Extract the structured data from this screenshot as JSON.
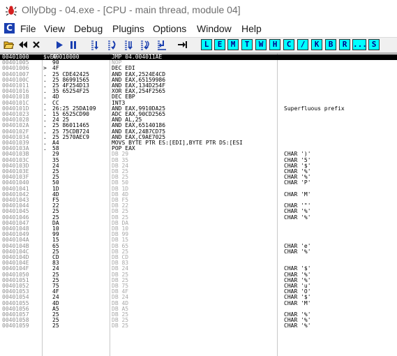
{
  "window": {
    "title": "OllyDbg - 04.exe - [CPU - main thread, module 04]"
  },
  "menu": {
    "logo": "C",
    "items": [
      "File",
      "View",
      "Debug",
      "Plugins",
      "Options",
      "Window",
      "Help"
    ]
  },
  "toolbar": {
    "icons": [
      "open-folder-icon",
      "rewind-icon",
      "close-icon",
      "run-icon",
      "pause-icon",
      "step-into-icon",
      "step-over-icon",
      "trace-into-icon",
      "trace-over-icon",
      "execute-till-return-icon",
      "go-to-icon"
    ],
    "letters": [
      "L",
      "E",
      "M",
      "T",
      "W",
      "H",
      "C",
      "/",
      "K",
      "B",
      "R",
      "...",
      "S"
    ],
    "letter_color": "#00ffff"
  },
  "disasm": {
    "rows": [
      {
        "addr": "00401000",
        "mark": "$vE9",
        "hex": "A9010000",
        "dis": "JMP 04.004011AE",
        "com": "",
        "sel": true
      },
      {
        "addr": "00401005",
        "mark": "",
        "hex": "90",
        "dis": "NOP",
        "com": "",
        "nop": true
      },
      {
        "addr": "00401006",
        "mark": ">",
        "hex": "4F",
        "dis": "DEC EDI",
        "com": ""
      },
      {
        "addr": "00401007",
        "mark": ".",
        "hex": "25 CDE42425",
        "dis": "AND EAX,2524E4CD",
        "com": ""
      },
      {
        "addr": "0040100C",
        "mark": ".",
        "hex": "25 86991565",
        "dis": "AND EAX,65159986",
        "com": ""
      },
      {
        "addr": "00401011",
        "mark": ".",
        "hex": "25 4F254D13",
        "dis": "AND EAX,134D254F",
        "com": ""
      },
      {
        "addr": "00401016",
        "mark": ".",
        "hex": "35 65254F25",
        "dis": "XOR EAX,254F2565",
        "com": ""
      },
      {
        "addr": "0040101B",
        "mark": ".",
        "hex": "4D",
        "dis": "DEC EBP",
        "com": ""
      },
      {
        "addr": "0040101C",
        "mark": ".",
        "hex": "CC",
        "dis": "INT3",
        "com": ""
      },
      {
        "addr": "0040101D",
        "mark": ".",
        "hex": "26:25 25DA109",
        "dis": "AND EAX,9910DA25",
        "com": "Superfluous prefix"
      },
      {
        "addr": "00401023",
        "mark": ".",
        "hex": "15 6525CD90",
        "dis": "ADC EAX,90CD2565",
        "com": ""
      },
      {
        "addr": "00401028",
        "mark": ".",
        "hex": "24 25",
        "dis": "AND AL,25",
        "com": ""
      },
      {
        "addr": "0040102A",
        "mark": ".",
        "hex": "25 86011465",
        "dis": "AND EAX,65140186",
        "com": ""
      },
      {
        "addr": "0040102F",
        "mark": ".",
        "hex": "25 75CDB724",
        "dis": "AND EAX,24B7CD75",
        "com": ""
      },
      {
        "addr": "00401034",
        "mark": ".",
        "hex": "25 2570AEC9",
        "dis": "AND EAX,C9AE7025",
        "com": ""
      },
      {
        "addr": "00401039",
        "mark": ".",
        "hex": "A4",
        "dis": "MOVS BYTE PTR ES:[EDI],BYTE PTR DS:[ESI",
        "com": ""
      },
      {
        "addr": "0040103A",
        "mark": ".",
        "hex": "58",
        "dis": "POP EAX",
        "com": ""
      },
      {
        "addr": "0040103B",
        "mark": "",
        "hex": "29",
        "dis": "DB 29",
        "com": "CHAR ')'",
        "db": true
      },
      {
        "addr": "0040103C",
        "mark": "",
        "hex": "35",
        "dis": "DB 35",
        "com": "CHAR '5'",
        "db": true
      },
      {
        "addr": "0040103D",
        "mark": "",
        "hex": "24",
        "dis": "DB 24",
        "com": "CHAR '$'",
        "db": true
      },
      {
        "addr": "0040103E",
        "mark": "",
        "hex": "25",
        "dis": "DB 25",
        "com": "CHAR '%'",
        "db": true
      },
      {
        "addr": "0040103F",
        "mark": "",
        "hex": "25",
        "dis": "DB 25",
        "com": "CHAR '%'",
        "db": true
      },
      {
        "addr": "00401040",
        "mark": "",
        "hex": "50",
        "dis": "DB 50",
        "com": "CHAR 'P'",
        "db": true
      },
      {
        "addr": "00401041",
        "mark": "",
        "hex": "1D",
        "dis": "DB 1D",
        "com": "",
        "db": true
      },
      {
        "addr": "00401042",
        "mark": "",
        "hex": "4D",
        "dis": "DB 4D",
        "com": "CHAR 'M'",
        "db": true
      },
      {
        "addr": "00401043",
        "mark": "",
        "hex": "F5",
        "dis": "DB F5",
        "com": "",
        "db": true
      },
      {
        "addr": "00401044",
        "mark": "",
        "hex": "22",
        "dis": "DB 22",
        "com": "CHAR '\"'",
        "db": true
      },
      {
        "addr": "00401045",
        "mark": "",
        "hex": "25",
        "dis": "DB 25",
        "com": "CHAR '%'",
        "db": true
      },
      {
        "addr": "00401046",
        "mark": "",
        "hex": "25",
        "dis": "DB 25",
        "com": "CHAR '%'",
        "db": true
      },
      {
        "addr": "00401047",
        "mark": "",
        "hex": "DA",
        "dis": "DB DA",
        "com": "",
        "db": true
      },
      {
        "addr": "00401048",
        "mark": "",
        "hex": "10",
        "dis": "DB 10",
        "com": "",
        "db": true
      },
      {
        "addr": "00401049",
        "mark": "",
        "hex": "99",
        "dis": "DB 99",
        "com": "",
        "db": true
      },
      {
        "addr": "0040104A",
        "mark": "",
        "hex": "15",
        "dis": "DB 15",
        "com": "",
        "db": true
      },
      {
        "addr": "0040104B",
        "mark": "",
        "hex": "65",
        "dis": "DB 65",
        "com": "CHAR 'e'",
        "db": true
      },
      {
        "addr": "0040104C",
        "mark": "",
        "hex": "25",
        "dis": "DB 25",
        "com": "CHAR '%'",
        "db": true
      },
      {
        "addr": "0040104D",
        "mark": "",
        "hex": "CD",
        "dis": "DB CD",
        "com": "",
        "db": true
      },
      {
        "addr": "0040104E",
        "mark": "",
        "hex": "83",
        "dis": "DB 83",
        "com": "",
        "db": true
      },
      {
        "addr": "0040104F",
        "mark": "",
        "hex": "24",
        "dis": "DB 24",
        "com": "CHAR '$'",
        "db": true
      },
      {
        "addr": "00401050",
        "mark": "",
        "hex": "25",
        "dis": "DB 25",
        "com": "CHAR '%'",
        "db": true
      },
      {
        "addr": "00401051",
        "mark": "",
        "hex": "25",
        "dis": "DB 25",
        "com": "CHAR '%'",
        "db": true
      },
      {
        "addr": "00401052",
        "mark": "",
        "hex": "75",
        "dis": "DB 75",
        "com": "CHAR 'u'",
        "db": true
      },
      {
        "addr": "00401053",
        "mark": "",
        "hex": "4F",
        "dis": "DB 4F",
        "com": "CHAR 'O'",
        "db": true
      },
      {
        "addr": "00401054",
        "mark": "",
        "hex": "24",
        "dis": "DB 24",
        "com": "CHAR '$'",
        "db": true
      },
      {
        "addr": "00401055",
        "mark": "",
        "hex": "4D",
        "dis": "DB 4D",
        "com": "CHAR 'M'",
        "db": true
      },
      {
        "addr": "00401056",
        "mark": "",
        "hex": "A5",
        "dis": "DB A5",
        "com": "",
        "db": true
      },
      {
        "addr": "00401057",
        "mark": "",
        "hex": "25",
        "dis": "DB 25",
        "com": "CHAR '%'",
        "db": true
      },
      {
        "addr": "00401058",
        "mark": "",
        "hex": "25",
        "dis": "DB 25",
        "com": "CHAR '%'",
        "db": true
      },
      {
        "addr": "00401059",
        "mark": "",
        "hex": "25",
        "dis": "DB 25",
        "com": "CHAR '%'",
        "db": true
      }
    ]
  }
}
